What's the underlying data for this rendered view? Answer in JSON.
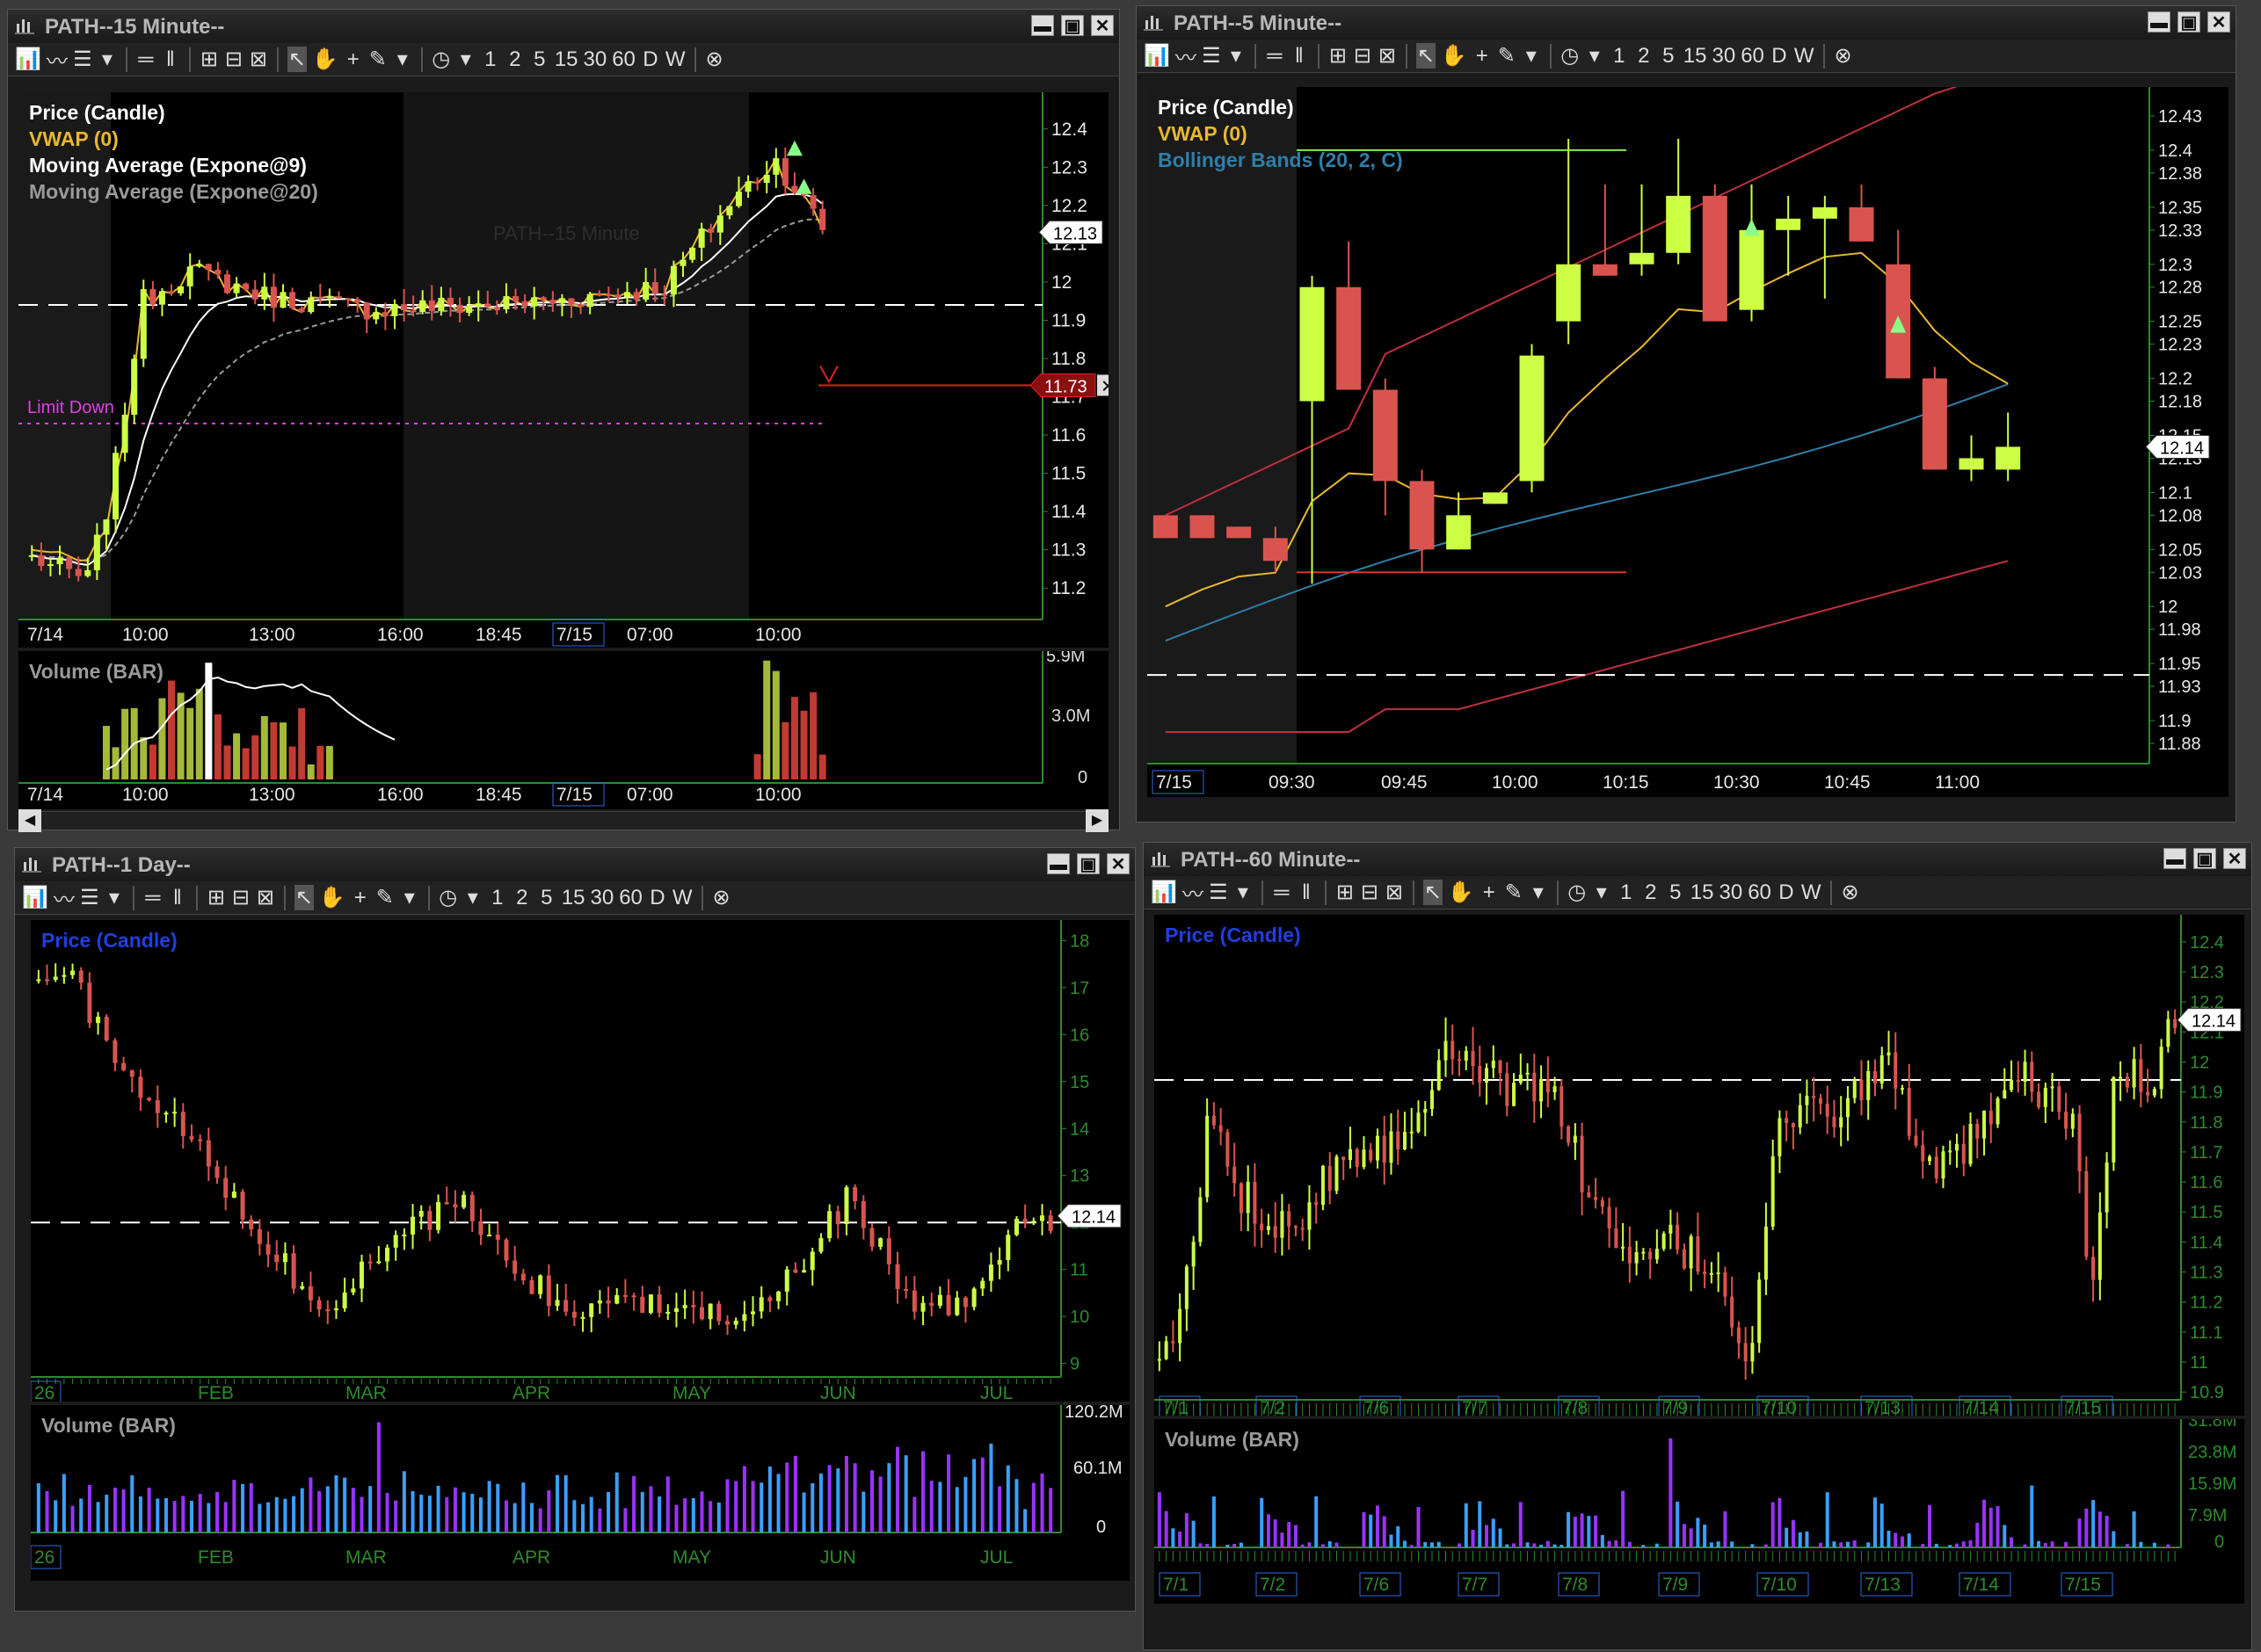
{
  "windows": {
    "w15": {
      "title": "PATH--15 Minute--",
      "legend": [
        "Price (Candle)",
        "VWAP (0)",
        "Moving Average (Expone@9)",
        "Moving Average (Expone@20)"
      ],
      "watermark": "PATH--15 Minute",
      "limit_label": "Limit Down",
      "price_tag": "12.13",
      "order_tag": "11.73",
      "volume_label": "Volume (BAR)"
    },
    "w5": {
      "title": "PATH--5 Minute--",
      "legend": [
        "Price (Candle)",
        "VWAP (0)",
        "Bollinger Bands (20, 2, C)"
      ],
      "price_tag": "12.14"
    },
    "w1d": {
      "title": "PATH--1 Day--",
      "legend": [
        "Price (Candle)"
      ],
      "price_tag": "12.14",
      "volume_label": "Volume (BAR)"
    },
    "w60": {
      "title": "PATH--60 Minute--",
      "legend": [
        "Price (Candle)"
      ],
      "price_tag": "12.14",
      "volume_label": "Volume (BAR)"
    }
  },
  "window_buttons": [
    "▬",
    "▣",
    "✕"
  ],
  "toolbar": [
    "1",
    "2",
    "5",
    "15",
    "30",
    "60",
    "D",
    "W"
  ],
  "colors": {
    "up": "#ccff44",
    "down": "#d9544f",
    "vwap": "#e8b830",
    "ema9": "#ffffff",
    "ema20": "#9a9a9a",
    "axis": "#2e8b2e",
    "bb": "#c03040",
    "bb_mid": "#2f7fa8",
    "vol_blue": "#3aa0ff",
    "vol_purple": "#9933ff"
  },
  "chart_data": [
    {
      "id": "15min",
      "type": "candlestick",
      "yticks": [
        "12.4",
        "12.3",
        "12.2",
        "12.1",
        "12",
        "11.9",
        "11.8",
        "11.7",
        "11.6",
        "11.5",
        "11.4",
        "11.3",
        "11.2"
      ],
      "ylim": [
        11.15,
        12.45
      ],
      "xticks": [
        "7/14",
        "10:00",
        "13:00",
        "16:00",
        "18:45",
        "7/15",
        "07:00",
        "10:00"
      ],
      "ref_line": 11.94,
      "limit_down": 11.63,
      "order_line": 11.73,
      "last": 12.13,
      "volume_ticks": [
        "5.9M",
        "3.0M",
        "0"
      ],
      "volume_xticks": [
        "7/14",
        "10:00",
        "13:00",
        "16:00",
        "18:45",
        "7/15",
        "07:00",
        "10:00"
      ]
    },
    {
      "id": "5min",
      "type": "candlestick",
      "yticks": [
        "12.43",
        "12.4",
        "12.38",
        "12.35",
        "12.33",
        "12.3",
        "12.28",
        "12.25",
        "12.23",
        "12.2",
        "12.18",
        "12.15",
        "12.13",
        "12.1",
        "12.08",
        "12.05",
        "12.03",
        "12",
        "11.98",
        "11.95",
        "11.93",
        "11.9",
        "11.88"
      ],
      "ylim": [
        11.87,
        12.44
      ],
      "xticks": [
        "7/15",
        "09:30",
        "09:45",
        "10:00",
        "10:15",
        "10:30",
        "10:45",
        "11:00"
      ],
      "ref_line": 11.94,
      "upper_level": 12.4,
      "lower_level": 12.03,
      "last": 12.14,
      "candles": [
        [
          12.08,
          12.08,
          12.06,
          12.06
        ],
        [
          12.08,
          12.08,
          12.06,
          12.06
        ],
        [
          12.07,
          12.07,
          12.06,
          12.06
        ],
        [
          12.06,
          12.07,
          12.03,
          12.04
        ],
        [
          12.18,
          12.29,
          12.02,
          12.28
        ],
        [
          12.28,
          12.32,
          12.19,
          12.19
        ],
        [
          12.19,
          12.2,
          12.08,
          12.11
        ],
        [
          12.11,
          12.12,
          12.03,
          12.05
        ],
        [
          12.05,
          12.1,
          12.05,
          12.08
        ],
        [
          12.09,
          12.1,
          12.09,
          12.1
        ],
        [
          12.11,
          12.23,
          12.1,
          12.22
        ],
        [
          12.25,
          12.41,
          12.23,
          12.3
        ],
        [
          12.3,
          12.37,
          12.29,
          12.29
        ],
        [
          12.3,
          12.37,
          12.29,
          12.31
        ],
        [
          12.31,
          12.41,
          12.3,
          12.36
        ],
        [
          12.36,
          12.37,
          12.25,
          12.25
        ],
        [
          12.26,
          12.37,
          12.25,
          12.33
        ],
        [
          12.33,
          12.36,
          12.29,
          12.34
        ],
        [
          12.34,
          12.36,
          12.27,
          12.35
        ],
        [
          12.35,
          12.37,
          12.32,
          12.32
        ],
        [
          12.3,
          12.33,
          12.2,
          12.2
        ],
        [
          12.2,
          12.21,
          12.12,
          12.12
        ],
        [
          12.12,
          12.15,
          12.11,
          12.13
        ],
        [
          12.12,
          12.17,
          12.11,
          12.14
        ]
      ]
    },
    {
      "id": "1day",
      "type": "candlestick",
      "yticks": [
        "18",
        "17",
        "16",
        "15",
        "14",
        "13",
        "12",
        "11",
        "10",
        "9"
      ],
      "ylim": [
        8.9,
        18.1
      ],
      "xticks": [
        "26",
        "FEB",
        "MAR",
        "APR",
        "MAY",
        "JUN",
        "JUL"
      ],
      "ref_line": 12.0,
      "last": 12.14,
      "volume_ticks": [
        "120.2M",
        "60.1M",
        "0"
      ]
    },
    {
      "id": "60min",
      "type": "candlestick",
      "yticks": [
        "12.4",
        "12.3",
        "12.2",
        "12.1",
        "12",
        "11.9",
        "11.8",
        "11.7",
        "11.6",
        "11.5",
        "11.4",
        "11.3",
        "11.2",
        "11.1",
        "11",
        "10.9"
      ],
      "ylim": [
        10.88,
        12.42
      ],
      "xticks": [
        "7/1",
        "7/2",
        "7/6",
        "7/7",
        "7/8",
        "7/9",
        "7/10",
        "7/13",
        "7/14",
        "7/15"
      ],
      "ref_line": 11.94,
      "last": 12.14,
      "volume_ticks": [
        "31.8M",
        "23.8M",
        "15.9M",
        "7.9M",
        "0"
      ]
    }
  ]
}
